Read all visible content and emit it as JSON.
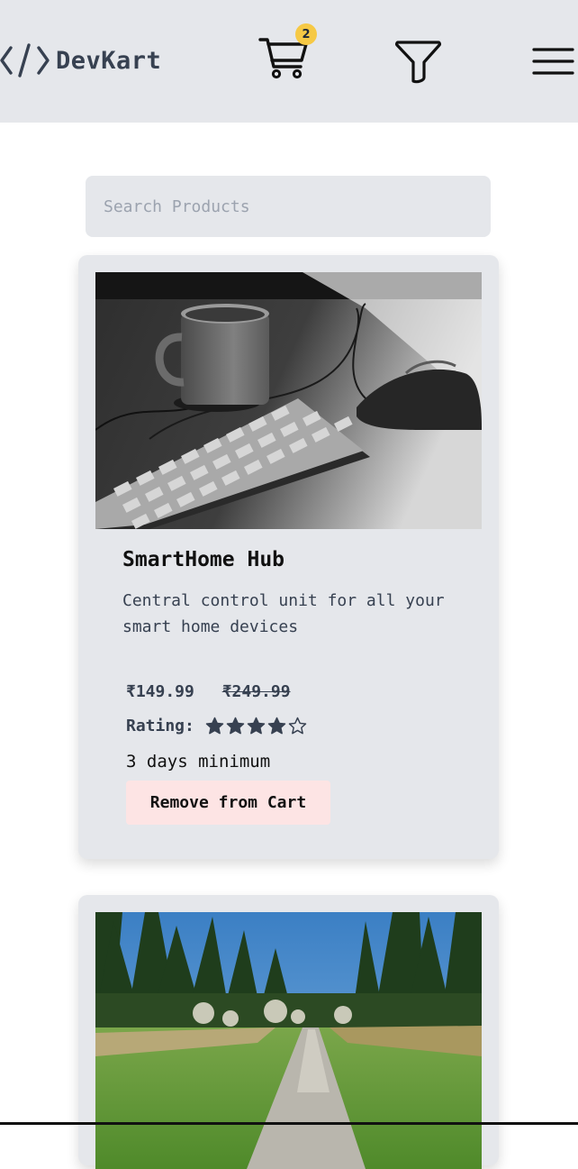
{
  "header": {
    "logo_icon": "code-brackets-icon",
    "brand": "DevKart",
    "cart_icon": "shopping-cart-icon",
    "cart_count": "2",
    "filter_icon": "filter-funnel-icon",
    "menu_icon": "hamburger-menu-icon"
  },
  "search": {
    "placeholder": "Search Products",
    "value": ""
  },
  "products": [
    {
      "image": "black-and-white photo of coffee mug, keyboard and hand on mouse",
      "title": "SmartHome Hub",
      "description": "Central control unit for all your smart home devices",
      "price": "₹149.99",
      "original_price": "₹249.99",
      "rating_label": "Rating:",
      "rating": 4,
      "rating_max": 5,
      "duration": "3 days minimum",
      "action": "Remove from Cart"
    },
    {
      "image": "landscape photo of a gravel path through a meadow between pine trees"
    }
  ],
  "colors": {
    "header_bg": "#e5e7eb",
    "card_bg": "#e5e7eb",
    "badge": "#f6c945",
    "remove_button_bg": "#fde4e4",
    "star": "#374151"
  }
}
